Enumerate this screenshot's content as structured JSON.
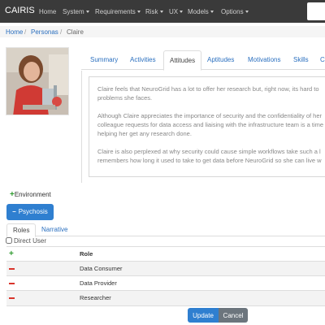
{
  "navbar": {
    "brand": "CAIRIS",
    "items": [
      {
        "label": "Home"
      },
      {
        "label": "System"
      },
      {
        "label": "Requirements"
      },
      {
        "label": "Risk"
      },
      {
        "label": "UX"
      },
      {
        "label": "Models"
      },
      {
        "label": "Options"
      }
    ]
  },
  "breadcrumb": {
    "items": [
      "Home",
      "Personas",
      "Claire"
    ],
    "separator": "/"
  },
  "persona_photo": {
    "alt_icon": "persona-photo"
  },
  "tabs": [
    {
      "label": "Summary"
    },
    {
      "label": "Activities"
    },
    {
      "label": "Attitudes"
    },
    {
      "label": "Aptitudes"
    },
    {
      "label": "Motivations"
    },
    {
      "label": "Skills"
    },
    {
      "label": "C"
    }
  ],
  "active_tab": "Attitudes",
  "attitudes": {
    "paragraphs": [
      "Claire feels that NeuroGrid has a lot to offer her research but, right now, its hard to",
      "problems she faces.",
      "Although Claire appreciates the importance of security and the confidentiality of her",
      "colleague requests for data access and liaising with the infrastructure team is a time",
      "helping her get any research done.",
      "Claire is also perplexed at why security could cause simple workflows take such a l",
      "remembers how long it used to take to get data before NeuroGrid so she can live w"
    ]
  },
  "environment": {
    "add_label": "Environment",
    "selected": "Psychosis"
  },
  "subtabs": [
    {
      "label": "Roles"
    },
    {
      "label": "Narrative"
    }
  ],
  "direct_user": {
    "label": "Direct User",
    "checked": false
  },
  "roles_table": {
    "header": "Role",
    "rows": [
      {
        "role": "Data Consumer"
      },
      {
        "role": "Data Provider"
      },
      {
        "role": "Researcher"
      }
    ]
  },
  "actions": {
    "update_label": "Update",
    "cancel_label": "Cancel"
  },
  "colors": {
    "navbar": "#3a3a3a",
    "primary": "#2f7fd0",
    "secondary": "#6c757d",
    "add": "#2e9a2e",
    "remove": "#d9342b",
    "link": "#2a6fbf"
  }
}
